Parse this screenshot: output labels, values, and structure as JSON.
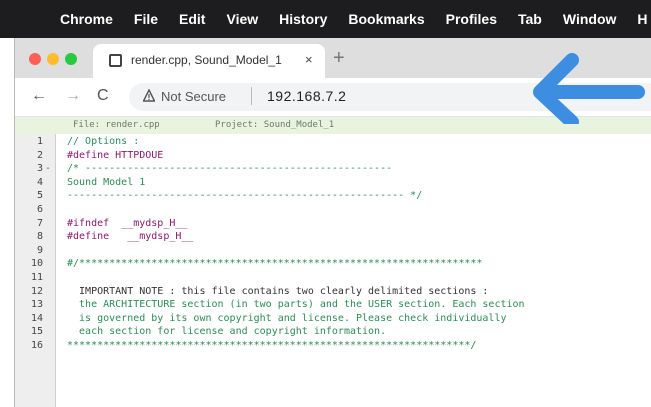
{
  "menubar": {
    "items": [
      "Chrome",
      "File",
      "Edit",
      "View",
      "History",
      "Bookmarks",
      "Profiles",
      "Tab",
      "Window",
      "H"
    ]
  },
  "tab": {
    "title": "render.cpp, Sound_Model_1",
    "close": "×"
  },
  "newtab": "+",
  "toolbar": {
    "back": "←",
    "forward": "→",
    "reload": "C",
    "security": "Not Secure",
    "url": "192.168.7.2"
  },
  "filebar": {
    "file": "File: render.cpp",
    "project": "Project: Sound_Model_1"
  },
  "code": {
    "lines": [
      {
        "n": "1",
        "fold": "",
        "text": "// Options :",
        "cls": "c-comment"
      },
      {
        "n": "2",
        "fold": "",
        "text": "#define HTTPDOUE",
        "cls": "c-dir"
      },
      {
        "n": "3",
        "fold": "-",
        "text": "/* ---------------------------------------------------",
        "cls": "c-comment"
      },
      {
        "n": "4",
        "fold": "",
        "text": "Sound Model 1",
        "cls": "c-comment"
      },
      {
        "n": "5",
        "fold": "",
        "text": "-------------------------------------------------------- */",
        "cls": "c-comment"
      },
      {
        "n": "6",
        "fold": "",
        "text": "",
        "cls": "c-text"
      },
      {
        "n": "7",
        "fold": "",
        "text": "#ifndef  __mydsp_H__",
        "cls": "c-dir"
      },
      {
        "n": "8",
        "fold": "",
        "text": "#define   __mydsp_H__",
        "cls": "c-dir"
      },
      {
        "n": "9",
        "fold": "",
        "text": "",
        "cls": "c-text"
      },
      {
        "n": "10",
        "fold": "",
        "text": "#/*******************************************************************",
        "cls": "c-comment"
      },
      {
        "n": "11",
        "fold": "",
        "text": "",
        "cls": "c-text"
      },
      {
        "n": "12",
        "fold": "",
        "text": "  IMPORTANT NOTE : this file contains two clearly delimited sections :",
        "cls": "c-text"
      },
      {
        "n": "13",
        "fold": "",
        "text": "  the ARCHITECTURE section (in two parts) and the USER section. Each section",
        "cls": "c-comment"
      },
      {
        "n": "14",
        "fold": "",
        "text": "  is governed by its own copyright and license. Please check individually",
        "cls": "c-comment"
      },
      {
        "n": "15",
        "fold": "",
        "text": "  each section for license and copyright information.",
        "cls": "c-comment"
      },
      {
        "n": "16",
        "fold": "",
        "text": "*******************************************************************/",
        "cls": "c-comment"
      }
    ]
  },
  "colors": {
    "menubar_bg": "#1d1d1f",
    "arrow": "#3d8de0",
    "comment": "#2e8b57",
    "directive": "#8b1a6b"
  }
}
